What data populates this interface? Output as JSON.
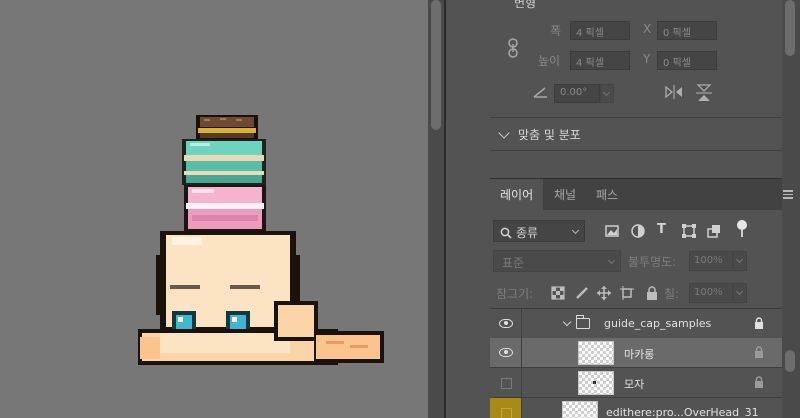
{
  "properties": {
    "section_partial_title": "변형",
    "width_label": "폭",
    "width_value": "4 픽셀",
    "height_label": "높이",
    "height_value": "4 픽셀",
    "x_label": "X",
    "x_value": "0 픽셀",
    "y_label": "Y",
    "y_value": "0 픽셀",
    "angle_value": "0.00°",
    "align_section_title": "맞춤 및 분포"
  },
  "tabs": [
    {
      "label": "레이어",
      "active": true
    },
    {
      "label": "채널",
      "active": false
    },
    {
      "label": "패스",
      "active": false
    }
  ],
  "layer_filter": {
    "kind_label": "종류",
    "icons": [
      "image-filter-icon",
      "adjustment-filter-icon",
      "type-filter-icon",
      "shape-filter-icon",
      "smart-object-filter-icon"
    ],
    "type_glyph": "T"
  },
  "blend": {
    "mode": "표준",
    "opacity_label": "불투명도:",
    "opacity_value": "100%",
    "lock_label": "잠그기:",
    "fill_label": "칠:",
    "fill_value": "100%"
  },
  "layers": [
    {
      "name": "guide_cap_samples",
      "type": "group",
      "visible": true,
      "locked": true,
      "selected": false
    },
    {
      "name": "마카롱",
      "type": "layer",
      "visible": true,
      "locked": true,
      "selected": true
    },
    {
      "name": "모자",
      "type": "layer",
      "visible": false,
      "locked": true,
      "selected": false
    },
    {
      "name": "edithere:pro...OverHead_31",
      "type": "layer",
      "visible": false,
      "locked": false,
      "selected": false,
      "tag_color": "#a88a17"
    }
  ],
  "colors": {
    "panel_bg": "#535353",
    "canvas_bg": "#777777",
    "selected_row": "#6a6a6a",
    "tag_yellow": "#a88a17"
  }
}
